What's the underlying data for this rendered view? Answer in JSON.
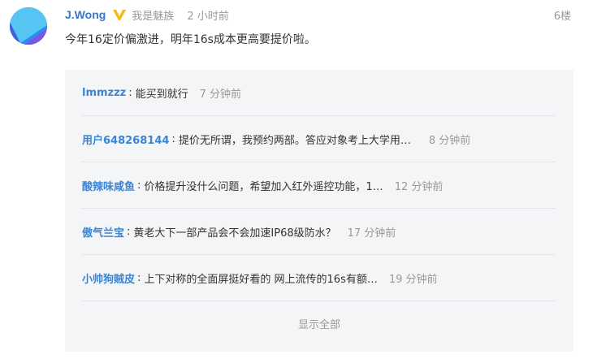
{
  "post": {
    "user_name": "J.Wong",
    "user_signature": "我是魅族",
    "time": "2 小时前",
    "floor": "6楼",
    "content": "今年16定价偏激进，明年16s成本更高要提价啦。",
    "verify_icon": "v-verified-badge-icon",
    "avatar_colors": [
      "#2a8cf0",
      "#56c5f3",
      "#7b57e0"
    ]
  },
  "replies": [
    {
      "user": "lmmzzz",
      "separator": ":",
      "text": "能买到就行",
      "time": "7 分钟前"
    },
    {
      "user": "用户648268144",
      "separator": ":",
      "text": "提价无所谓，我预约两部。答应对象考上大学用…",
      "time": "8 分钟前"
    },
    {
      "user": "酸辣味咸鱼",
      "separator": ":",
      "text": "价格提升没什么问题，希望加入红外遥控功能，1…",
      "time": "12 分钟前"
    },
    {
      "user": "傲气兰宝",
      "separator": ":",
      "text": "黄老大下一部产品会不会加速IP68级防水？",
      "time": "17 分钟前"
    },
    {
      "user": "小帅狗贼皮",
      "separator": ":",
      "text": "上下对称的全面屏挺好看的 网上流传的16s有额…",
      "time": "19 分钟前"
    }
  ],
  "show_all_label": "显示全部",
  "colors": {
    "username": "#3a77c4",
    "reply_user": "#3a86d6",
    "muted": "#999999",
    "reply_bg": "#f4f5f7"
  }
}
